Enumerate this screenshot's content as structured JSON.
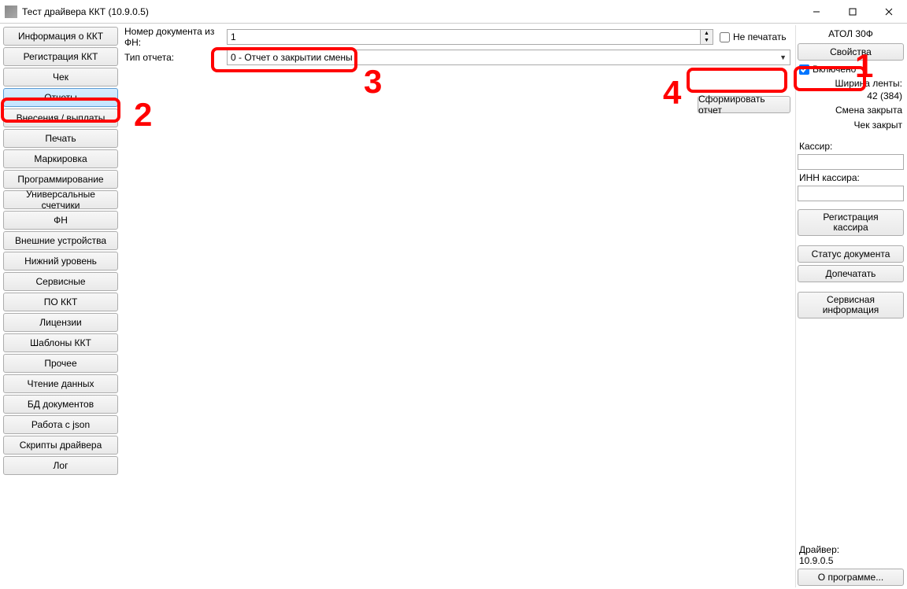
{
  "window": {
    "title": "Тест драйвера ККТ (10.9.0.5)"
  },
  "annotations": {
    "a1": "1",
    "a2": "2",
    "a3": "3",
    "a4": "4"
  },
  "nav": {
    "items": [
      "Информация о ККТ",
      "Регистрация ККТ",
      "Чек",
      "Отчеты",
      "Внесения / выплаты",
      "Печать",
      "Маркировка",
      "Программирование",
      "Универсальные счетчики",
      "ФН",
      "Внешние устройства",
      "Нижний уровень",
      "Сервисные",
      "ПО ККТ",
      "Лицензии",
      "Шаблоны ККТ",
      "Прочее",
      "Чтение данных",
      "БД документов",
      "Работа с json",
      "Скрипты драйвера",
      "Лог"
    ]
  },
  "form": {
    "doc_num_label": "Номер документа из ФН:",
    "doc_num_value": "1",
    "report_type_label": "Тип отчета:",
    "report_type_value": "0 - Отчет о закрытии смены",
    "no_print_label": "Не печатать",
    "generate_label": "Сформировать отчет"
  },
  "right": {
    "device": "АТОЛ 30Ф",
    "props_btn": "Свойства",
    "enabled_label": "Включено",
    "tape_label": "Ширина ленты:",
    "tape_value": "42 (384)",
    "shift": "Смена закрыта",
    "check": "Чек закрыт",
    "cashier_label": "Кассир:",
    "cashier_inn_label": "ИНН кассира:",
    "reg_cashier_btn": "Регистрация\nкассира",
    "doc_status_btn": "Статус документа",
    "reprint_btn": "Допечатать",
    "service_btn": "Сервисная\nинформация",
    "driver_label": "Драйвер:",
    "driver_ver": "10.9.0.5",
    "about_btn": "О программе..."
  }
}
